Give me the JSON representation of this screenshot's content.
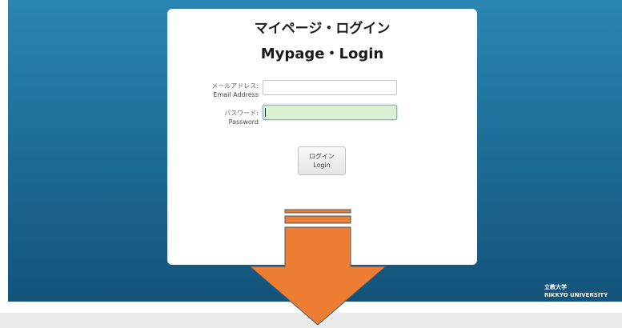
{
  "login": {
    "title_ja": "マイページ・ログイン",
    "title_en": "Mypage・Login",
    "email_label_ja": "メールアドレス:",
    "email_label_en": "Email Address",
    "email_value": "",
    "password_label_ja": "パスワード:",
    "password_label_en": "Password",
    "password_value": "",
    "login_button_ja": "ログイン",
    "login_button_en": "Login"
  },
  "branding": {
    "logo_ja": "立教大学",
    "logo_en": "RIKKYO UNIVERSITY"
  },
  "overlay": {
    "arrow_icon": "down-arrow-icon",
    "arrow_color": "#ed7d31"
  },
  "colors": {
    "background": "#1e6f99",
    "password_focus": "#d9f0d2"
  }
}
